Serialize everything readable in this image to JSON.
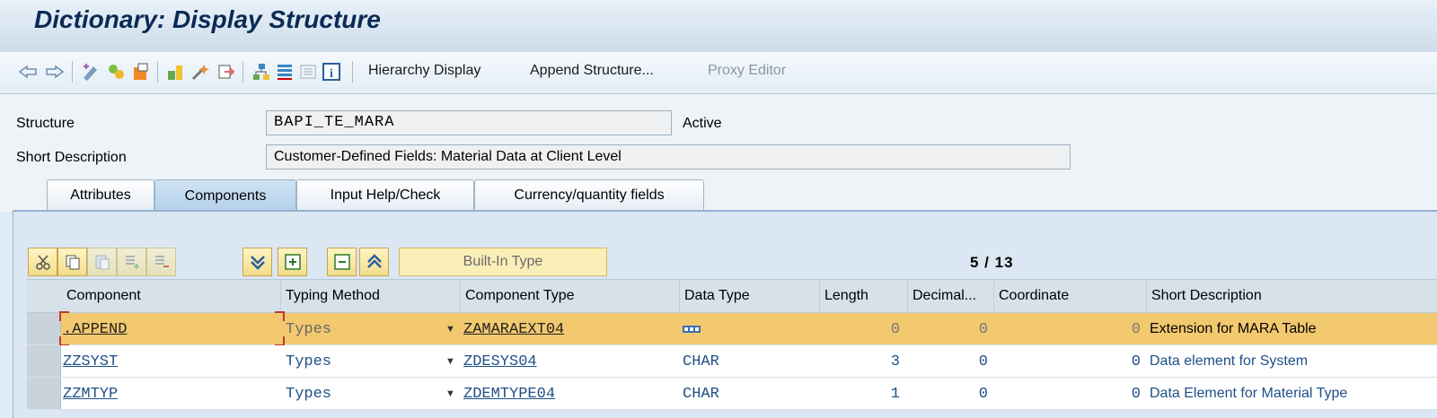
{
  "window": {
    "title": "Dictionary: Display Structure"
  },
  "toolbar": {
    "hierarchy_display": "Hierarchy Display",
    "append_structure": "Append Structure...",
    "proxy_editor": "Proxy Editor",
    "icons": [
      "back-icon",
      "forward-icon",
      "display-change-icon",
      "other-object-icon",
      "where-used-icon",
      "activate-icon",
      "check-icon",
      "test-icon",
      "object-list-icon",
      "hierarchy-icon",
      "technical-settings-icon",
      "info-icon"
    ]
  },
  "header": {
    "structure_label": "Structure",
    "structure_value": "BAPI_TE_MARA",
    "status": "Active",
    "short_desc_label": "Short Description",
    "short_desc_value": "Customer-Defined Fields: Material Data at Client Level"
  },
  "tabs": [
    {
      "label": "Attributes",
      "active": false
    },
    {
      "label": "Components",
      "active": true
    },
    {
      "label": "Input Help/Check",
      "active": false
    },
    {
      "label": "Currency/quantity fields",
      "active": false
    }
  ],
  "grid_toolbar": {
    "builtin_type": "Built-In Type",
    "counter": "5 / 13"
  },
  "table": {
    "columns": [
      "Component",
      "Typing Method",
      "Component Type",
      "Data Type",
      "Length",
      "Decimal...",
      "Coordinate",
      "Short Description"
    ],
    "rows": [
      {
        "component": ".APPEND",
        "typing": "Types",
        "comp_type": "ZAMARAEXT04",
        "data_type": "",
        "length": "0",
        "decimal": "0",
        "coordinate": "0",
        "desc": "Extension for MARA Table",
        "selected": true
      },
      {
        "component": "ZZSYST",
        "typing": "Types",
        "comp_type": "ZDESYS04",
        "data_type": "CHAR",
        "length": "3",
        "decimal": "0",
        "coordinate": "0",
        "desc": "Data element for System",
        "selected": false
      },
      {
        "component": "ZZMTYP",
        "typing": "Types",
        "comp_type": "ZDEMTYPE04",
        "data_type": "CHAR",
        "length": "1",
        "decimal": "0",
        "coordinate": "0",
        "desc": "Data Element for Material Type",
        "selected": false
      }
    ]
  },
  "colors": {
    "selected_row": "#f3c96f",
    "title": "#0b2a55",
    "link": "#1f4f86"
  }
}
